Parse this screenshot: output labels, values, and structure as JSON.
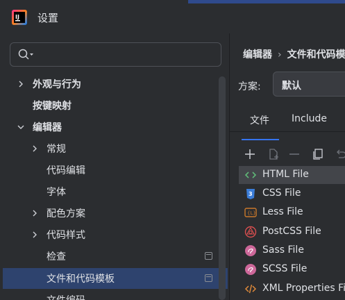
{
  "window": {
    "title": "设置"
  },
  "search": {
    "value": "",
    "placeholder": ""
  },
  "tree": {
    "items": [
      {
        "label": "外观与行为",
        "bold": true,
        "chevron": "right"
      },
      {
        "label": "按键映射",
        "bold": true,
        "chevron": ""
      },
      {
        "label": "编辑器",
        "bold": true,
        "chevron": "down"
      },
      {
        "label": "常规",
        "bold": false,
        "chevron": "right"
      },
      {
        "label": "代码编辑",
        "bold": false,
        "chevron": ""
      },
      {
        "label": "字体",
        "bold": false,
        "chevron": ""
      },
      {
        "label": "配色方案",
        "bold": false,
        "chevron": "right"
      },
      {
        "label": "代码样式",
        "bold": false,
        "chevron": "right"
      },
      {
        "label": "检查",
        "bold": false,
        "chevron": ""
      },
      {
        "label": "文件和代码模板",
        "bold": false,
        "chevron": ""
      },
      {
        "label": "文件编码",
        "bold": false,
        "chevron": ""
      }
    ]
  },
  "breadcrumb": {
    "parent": "编辑器",
    "separator": "›",
    "current": "文件和代码模板"
  },
  "scheme": {
    "label": "方案:",
    "value": "默认"
  },
  "tabs": [
    {
      "label": "文件"
    },
    {
      "label": "Include"
    }
  ],
  "toolbar": {
    "icons": [
      "add-icon",
      "copy-file-icon",
      "remove-icon",
      "duplicate-icon",
      "reset-icon"
    ]
  },
  "files": [
    {
      "name": "HTML File",
      "icon": "html-icon",
      "color": "#5fb878"
    },
    {
      "name": "CSS File",
      "icon": "css-icon",
      "color": "#3b7dd8"
    },
    {
      "name": "Less File",
      "icon": "less-icon",
      "color": "#c9782a"
    },
    {
      "name": "PostCSS File",
      "icon": "postcss-icon",
      "color": "#d94f4f"
    },
    {
      "name": "Sass File",
      "icon": "sass-icon",
      "color": "#cd6799"
    },
    {
      "name": "SCSS File",
      "icon": "scss-icon",
      "color": "#cd6799"
    },
    {
      "name": "XML Properties File",
      "icon": "xml-icon",
      "color": "#e08a3a"
    }
  ],
  "colors": {
    "accent": "#3574f0",
    "selection": "#2e436e",
    "background": "#2b2d30"
  }
}
